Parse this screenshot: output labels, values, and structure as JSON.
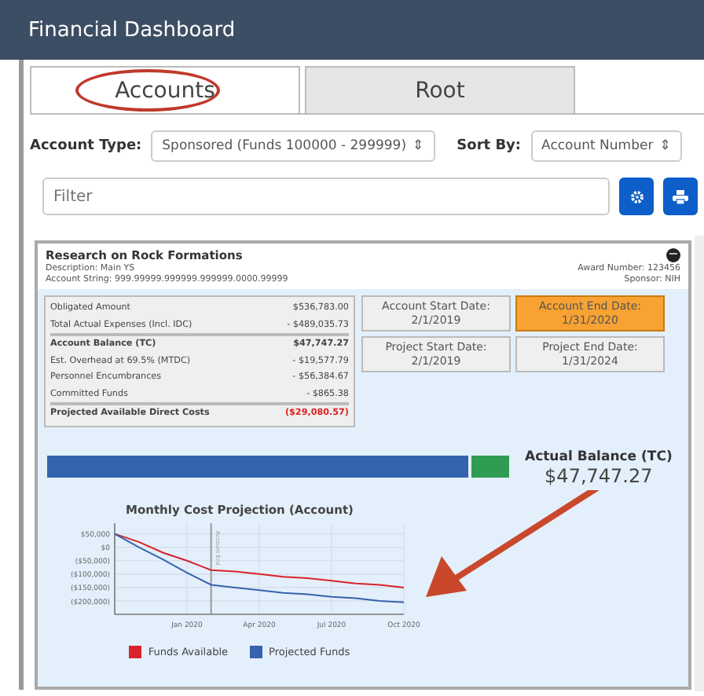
{
  "window": {
    "title": "Financial Dashboard"
  },
  "tabs": [
    {
      "label": "Accounts",
      "selected": true,
      "circled": true
    },
    {
      "label": "Root",
      "selected": false,
      "circled": false
    }
  ],
  "filters": {
    "account_type_label": "Account Type:",
    "account_type": "Sponsored (Funds 100000 - 299999)",
    "sort_by_label": "Sort By:",
    "sort_by": "Account Number",
    "select_glyph": "⇕",
    "filter_placeholder": "Filter"
  },
  "account": {
    "title": "Research on Rock Formations",
    "description": "Description: Main YS",
    "account_string": "Account String: 999.99999.999999.999999.0000.99999",
    "award_number": "Award Number: 123456",
    "sponsor": "Sponsor: NIH",
    "collapse_glyph": "−",
    "summary": [
      {
        "label": "Obligated Amount",
        "value": "$536,783.00",
        "kind": "plain"
      },
      {
        "label": "Total Actual Expenses (Incl. IDC)",
        "value": "- $489,035.73",
        "kind": "plain"
      },
      {
        "label": "Account Balance (TC)",
        "value": "$47,747.27",
        "kind": "total"
      },
      {
        "label": "Est. Overhead at 69.5% (MTDC)",
        "value": "- $19,577.79",
        "kind": "plain"
      },
      {
        "label": "Personnel Encumbrances",
        "value": "- $56,384.67",
        "kind": "plain"
      },
      {
        "label": "Committed Funds",
        "value": "- $865.38",
        "kind": "plain"
      },
      {
        "label": "Projected Available Direct Costs",
        "value": "($29,080.57)",
        "kind": "negative"
      }
    ],
    "dates": [
      {
        "label": "Account Start Date:",
        "value": "2/1/2019",
        "highlighted": false
      },
      {
        "label": "Account End Date:",
        "value": "1/31/2020",
        "highlighted": true
      },
      {
        "label": "Project Start Date:",
        "value": "2/1/2019",
        "highlighted": false
      },
      {
        "label": "Project End Date:",
        "value": "1/31/2024",
        "highlighted": false
      }
    ],
    "balance_bar": {
      "level": 0.91
    },
    "balance_label": "Actual Balance (TC)",
    "balance_value": "$47,747.27",
    "chart": {
      "chart_data": {
        "type": "line",
        "title": "Monthly Cost Projection (Account)",
        "categories": [
          null,
          null,
          null,
          "Jan 2020",
          null,
          null,
          "Apr 2020",
          null,
          null,
          "Jul 2020",
          null,
          null,
          "Oct 2020"
        ],
        "series": [
          {
            "name": "Funds Available",
            "color": "#d9222a",
            "values": [
              50000,
              20000,
              -20000,
              -50000,
              -85000,
              -90000,
              -100000,
              -110000,
              -115000,
              -125000,
              -135000,
              -140000,
              -150000
            ]
          },
          {
            "name": "Projected Funds",
            "color": "#3563ad",
            "values": [
              50000,
              0,
              -45000,
              -95000,
              -140000,
              -150000,
              -160000,
              -170000,
              -175000,
              -185000,
              -190000,
              -200000,
              -205000
            ]
          }
        ],
        "ylim": [
          -250000,
          90000
        ],
        "grid": true,
        "yticks": [
          {
            "value": 50000,
            "label": "$50,000"
          },
          {
            "value": 0,
            "label": "$0"
          },
          {
            "value": -50000,
            "label": "($50,000)"
          },
          {
            "value": -100000,
            "label": "($100,000)"
          },
          {
            "value": -150000,
            "label": "($150,000)"
          },
          {
            "value": -200000,
            "label": "($200,000)"
          }
        ],
        "annotations": [
          "Account End"
        ]
      }
    }
  }
}
